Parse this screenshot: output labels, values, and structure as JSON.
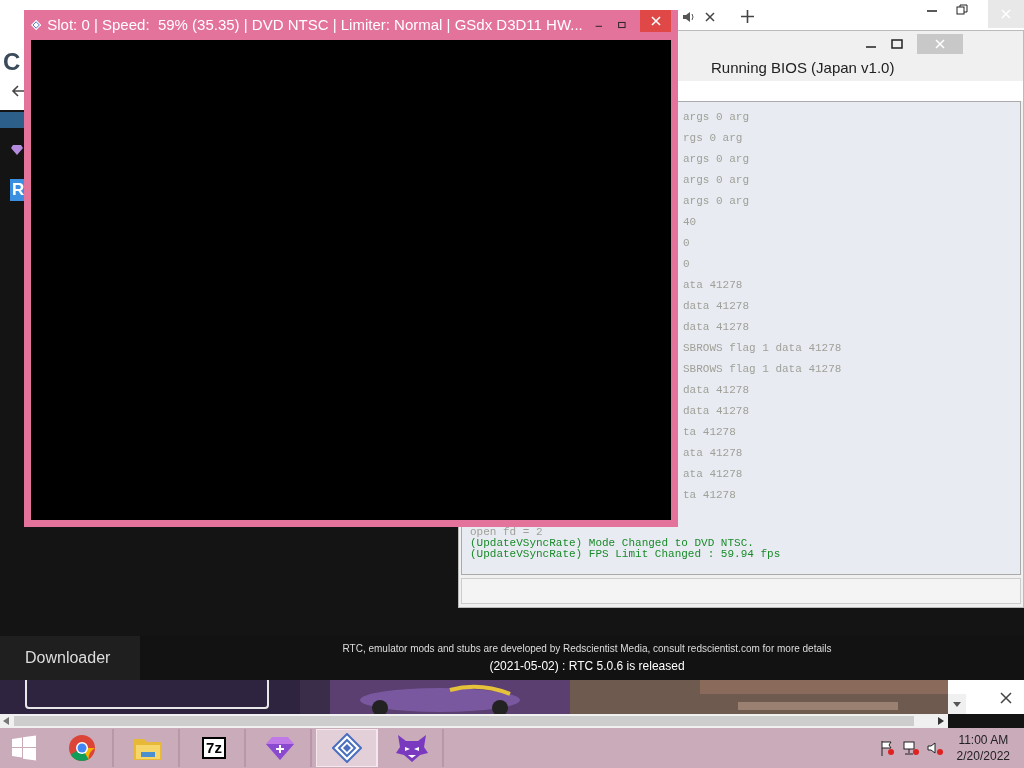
{
  "browser": {
    "page_letter": "C",
    "sidebar_badge": "R",
    "news": {
      "tab": "Downloader",
      "credits": "RTC, emulator mods and stubs are developed by Redscientist Media, consult redscientist.com for more details",
      "release": "(2021-05-02) : RTC 5.0.6 is released"
    }
  },
  "console": {
    "title": "Running BIOS (Japan v1.0)",
    "log": [
      {
        "text": "args 0 arg",
        "kind": "info",
        "cut": true
      },
      {
        "text": "rgs 0 arg",
        "kind": "info",
        "cut": true
      },
      {
        "text": "args 0 arg",
        "kind": "info",
        "cut": true
      },
      {
        "text": "args 0 arg",
        "kind": "info",
        "cut": true
      },
      {
        "text": "args 0 arg",
        "kind": "info",
        "cut": true
      },
      {
        "text": "40",
        "kind": "info",
        "cut": true
      },
      {
        "text": "0",
        "kind": "info",
        "cut": true
      },
      {
        "text": "0",
        "kind": "info",
        "cut": true
      },
      {
        "text": "ata 41278",
        "kind": "info",
        "cut": true
      },
      {
        "text": "data 41278",
        "kind": "info",
        "cut": true
      },
      {
        "text": "data 41278",
        "kind": "info",
        "cut": true
      },
      {
        "text": "SBROWS flag 1 data 41278",
        "kind": "info",
        "cut": true
      },
      {
        "text": "SBROWS flag 1 data 41278",
        "kind": "info",
        "cut": true
      },
      {
        "text": "data 41278",
        "kind": "info",
        "cut": true
      },
      {
        "text": "data 41278",
        "kind": "info",
        "cut": true
      },
      {
        "text": "ta 41278",
        "kind": "info",
        "cut": true
      },
      {
        "text": "ata 41278",
        "kind": "info",
        "cut": true
      },
      {
        "text": "ata 41278",
        "kind": "info",
        "cut": true
      },
      {
        "text": "ta 41278",
        "kind": "info",
        "cut": true
      },
      {
        "text": "open fd = 2",
        "kind": "info"
      },
      {
        "text": "(UpdateVSyncRate) Mode Changed to DVD NTSC.",
        "kind": "success"
      },
      {
        "text": "(UpdateVSyncRate) FPS Limit Changed : 59.94 fps",
        "kind": "success"
      }
    ]
  },
  "emulator": {
    "title": "Slot: 0 | Speed:  59% (35.35) | DVD NTSC | Limiter: Normal | GSdx D3D11 HW..."
  },
  "taskbar": {
    "apps": [
      {
        "kind": "start",
        "selected": false
      },
      {
        "kind": "chrome",
        "selected": false
      },
      {
        "kind": "folder",
        "selected": false
      },
      {
        "kind": "archiver",
        "label": "7z",
        "selected": false
      },
      {
        "kind": "gem",
        "selected": false
      },
      {
        "kind": "pcsx2",
        "selected": true
      },
      {
        "kind": "monster",
        "selected": false
      }
    ],
    "clock": {
      "time": "11:00 AM",
      "date": "2/20/2022"
    }
  }
}
